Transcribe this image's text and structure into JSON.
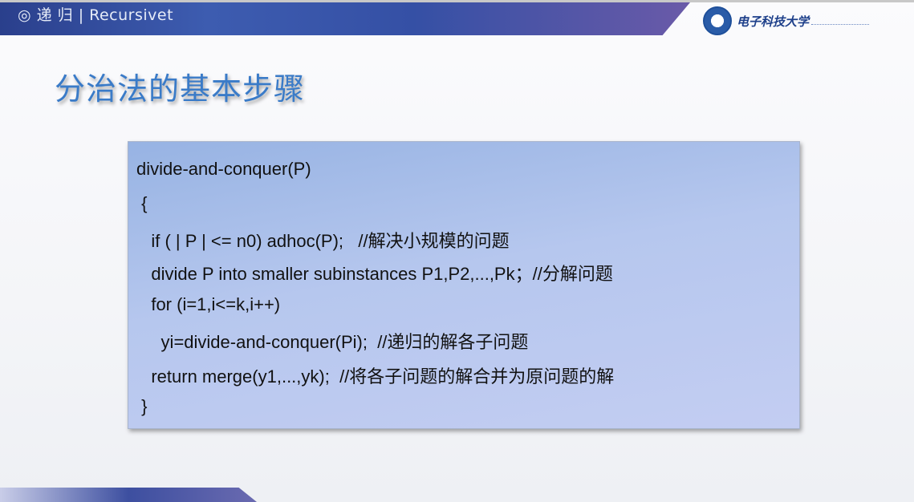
{
  "header": {
    "brand": "◎ 递 归 | Recursivet",
    "university": "电子科技大学"
  },
  "slide": {
    "title": "分治法的基本步骤",
    "code": [
      "divide-and-conquer(P)",
      " {",
      "   if ( | P | <= n0) adhoc(P);   //解决小规模的问题",
      "   divide P into smaller subinstances P1,P2,...,Pk；//分解问题",
      "   for (i=1,i<=k,i++)",
      "     yi=divide-and-conquer(Pi);  //递归的解各子问题",
      "   return merge(y1,...,yk);  //将各子问题的解合并为原问题的解",
      " }"
    ]
  },
  "colors": {
    "title": "#3a7bc8",
    "banner": "#3d5cb0",
    "codebox": "#b6c7ee"
  }
}
